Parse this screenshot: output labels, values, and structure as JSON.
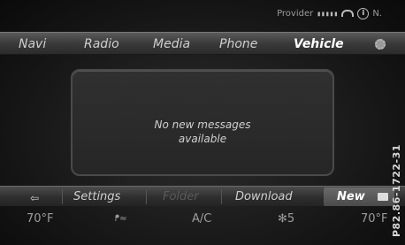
{
  "status_bar": {
    "provider_label": "Provider",
    "signal_bars": "▮▮▮▮▮",
    "info_icon_text": "i",
    "network": "N."
  },
  "top_menu": {
    "items": [
      "Navi",
      "Radio",
      "Media",
      "Phone",
      "Vehicle"
    ],
    "active": "Vehicle"
  },
  "message": {
    "line1": "No new messages",
    "line2": "available"
  },
  "bottom_menu": {
    "items": [
      "Settings",
      "Folder",
      "Download",
      "New"
    ],
    "disabled": "Folder",
    "selected": "New"
  },
  "climate": {
    "left_temp": "70°F",
    "ac_label": "A/C",
    "fan_speed": "5",
    "right_temp": "70°F"
  },
  "figure_code": "P82.86-1722-31"
}
